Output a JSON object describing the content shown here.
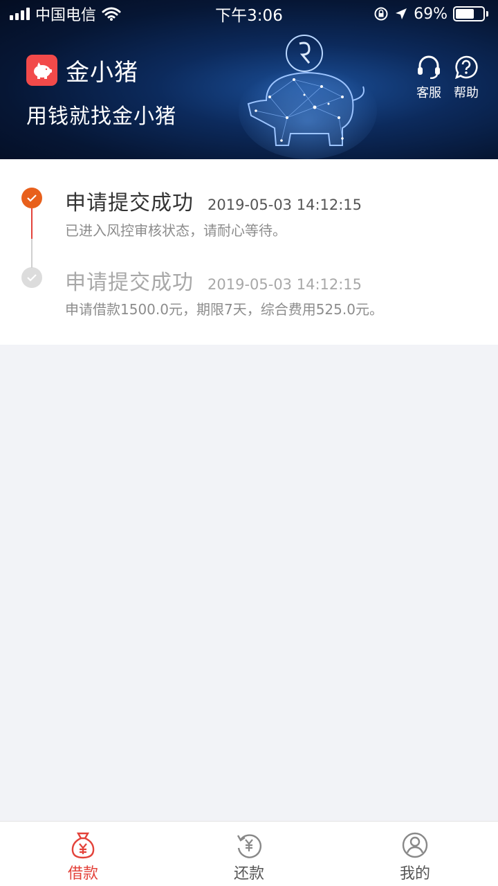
{
  "status_bar": {
    "carrier": "中国电信",
    "time": "下午3:06",
    "battery": "69%",
    "battery_level": 0.69
  },
  "header": {
    "app_name": "金小猪",
    "slogan": "用钱就找金小猪",
    "service_label": "客服",
    "help_label": "帮助"
  },
  "timeline": [
    {
      "title": "申请提交成功",
      "time": "2019-05-03 14:12:15",
      "desc": "已进入风控审核状态，请耐心等待。",
      "state": "active"
    },
    {
      "title": "申请提交成功",
      "time": "2019-05-03 14:12:15",
      "desc": "申请借款1500.0元，期限7天，综合费用525.0元。",
      "state": "done"
    }
  ],
  "tabbar": {
    "items": [
      {
        "label": "借款",
        "icon": "money-bag-icon",
        "active": true
      },
      {
        "label": "还款",
        "icon": "repay-cycle-icon",
        "active": false
      },
      {
        "label": "我的",
        "icon": "user-icon",
        "active": false
      }
    ]
  },
  "colors": {
    "accent": "#e3423a",
    "active_dot": "#e8601c",
    "inactive_dot": "#dcdcdc"
  }
}
